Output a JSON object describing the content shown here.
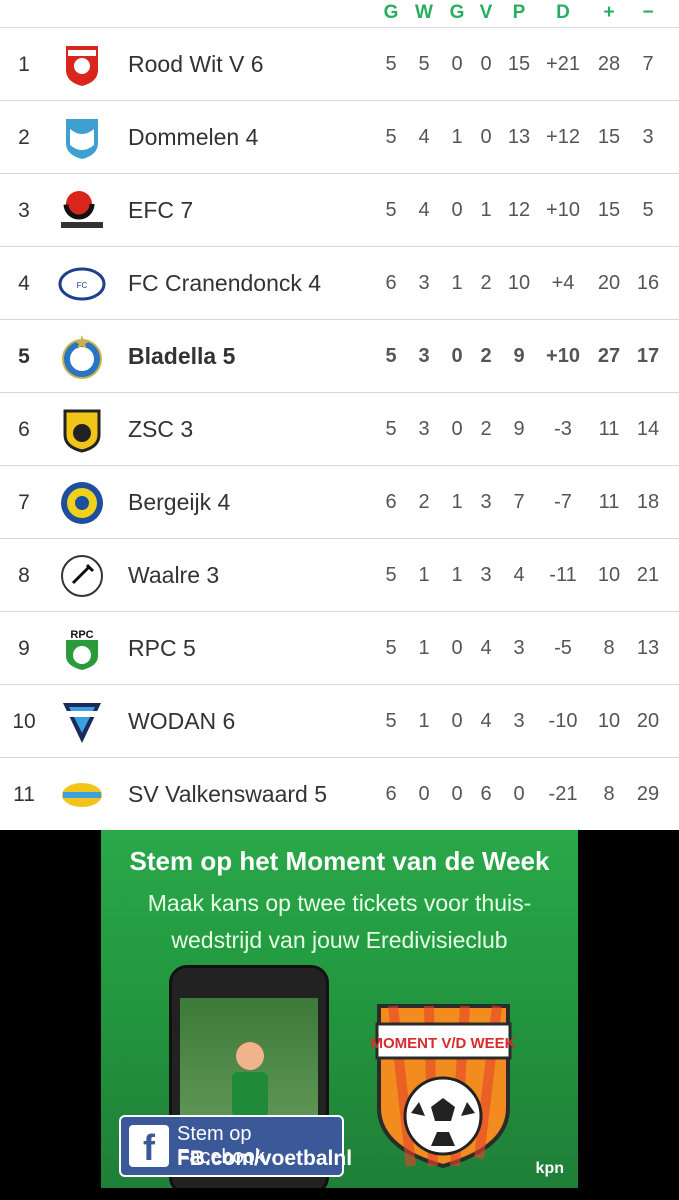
{
  "headers": [
    "G",
    "W",
    "G",
    "V",
    "P",
    "D",
    "+",
    "−"
  ],
  "rows": [
    {
      "rank": "1",
      "team": "Rood Wit V 6",
      "g": "5",
      "w": "5",
      "gl": "0",
      "v": "0",
      "p": "15",
      "d": "+21",
      "plus": "28",
      "minus": "7",
      "logo": "rood-wit-logo",
      "highlight": false
    },
    {
      "rank": "2",
      "team": "Dommelen 4",
      "g": "5",
      "w": "4",
      "gl": "1",
      "v": "0",
      "p": "13",
      "d": "+12",
      "plus": "15",
      "minus": "3",
      "logo": "dommelen-logo",
      "highlight": false
    },
    {
      "rank": "3",
      "team": "EFC 7",
      "g": "5",
      "w": "4",
      "gl": "0",
      "v": "1",
      "p": "12",
      "d": "+10",
      "plus": "15",
      "minus": "5",
      "logo": "efc-logo",
      "highlight": false
    },
    {
      "rank": "4",
      "team": "FC Cranendonck 4",
      "g": "6",
      "w": "3",
      "gl": "1",
      "v": "2",
      "p": "10",
      "d": "+4",
      "plus": "20",
      "minus": "16",
      "logo": "cranendonck-logo",
      "highlight": false
    },
    {
      "rank": "5",
      "team": "Bladella 5",
      "g": "5",
      "w": "3",
      "gl": "0",
      "v": "2",
      "p": "9",
      "d": "+10",
      "plus": "27",
      "minus": "17",
      "logo": "bladella-logo",
      "highlight": true
    },
    {
      "rank": "6",
      "team": "ZSC 3",
      "g": "5",
      "w": "3",
      "gl": "0",
      "v": "2",
      "p": "9",
      "d": "-3",
      "plus": "11",
      "minus": "14",
      "logo": "zsc-logo",
      "highlight": false
    },
    {
      "rank": "7",
      "team": "Bergeijk 4",
      "g": "6",
      "w": "2",
      "gl": "1",
      "v": "3",
      "p": "7",
      "d": "-7",
      "plus": "11",
      "minus": "18",
      "logo": "bergeijk-logo",
      "highlight": false
    },
    {
      "rank": "8",
      "team": "Waalre 3",
      "g": "5",
      "w": "1",
      "gl": "1",
      "v": "3",
      "p": "4",
      "d": "-11",
      "plus": "10",
      "minus": "21",
      "logo": "waalre-logo",
      "highlight": false
    },
    {
      "rank": "9",
      "team": "RPC 5",
      "g": "5",
      "w": "1",
      "gl": "0",
      "v": "4",
      "p": "3",
      "d": "-5",
      "plus": "8",
      "minus": "13",
      "logo": "rpc-logo",
      "highlight": false
    },
    {
      "rank": "10",
      "team": "WODAN 6",
      "g": "5",
      "w": "1",
      "gl": "0",
      "v": "4",
      "p": "3",
      "d": "-10",
      "plus": "10",
      "minus": "20",
      "logo": "wodan-logo",
      "highlight": false
    },
    {
      "rank": "11",
      "team": "SV Valkenswaard 5",
      "g": "6",
      "w": "0",
      "gl": "0",
      "v": "6",
      "p": "0",
      "d": "-21",
      "plus": "8",
      "minus": "29",
      "logo": "valkenswaard-logo",
      "highlight": false
    }
  ],
  "ad": {
    "title": "Stem op het Moment van de Week",
    "subtitle": "Maak kans op twee tickets voor thuis-wedstrijd van jouw Eredivisieclub",
    "badge_text": "MOMENT V/D WEEK",
    "fb_line1": "Stem op Facebook",
    "fb_line2": "FB.com/voetbalnl",
    "sponsor": "kpn"
  },
  "colors": {
    "accent": "#27ae60",
    "facebook": "#3b5998",
    "ad_green": "#2aa84a"
  }
}
